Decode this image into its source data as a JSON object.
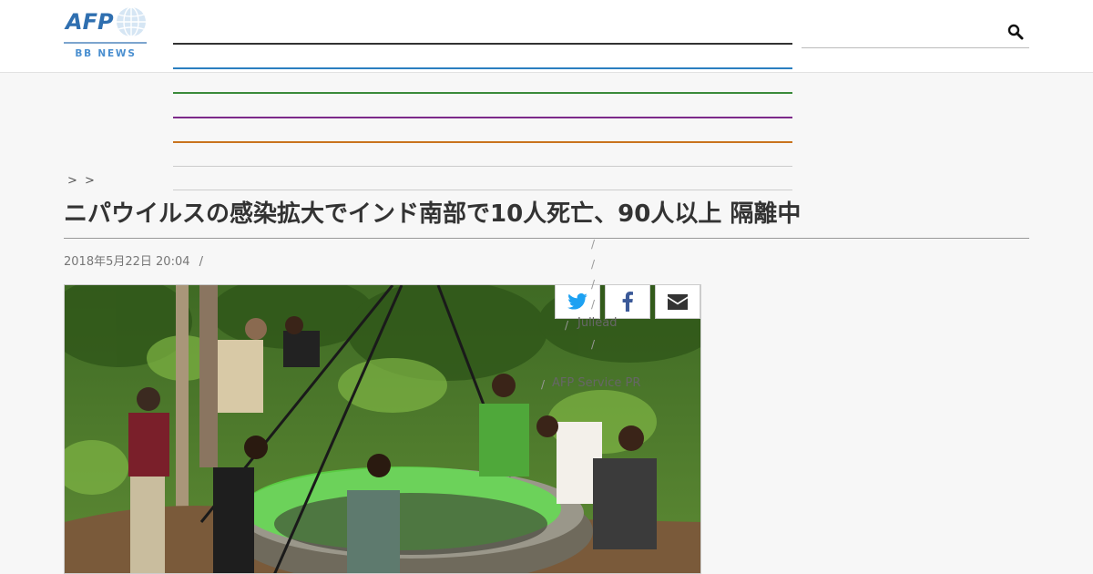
{
  "header": {
    "logo": {
      "brand": "AFP",
      "sub": "BB NEWS"
    },
    "nav_lines": [
      {
        "color": "#333333"
      },
      {
        "color": "#2a7fc0"
      },
      {
        "color": "#3a8a3a"
      },
      {
        "color": "#7d2a8a"
      },
      {
        "color": "#c9741e"
      },
      {
        "color": "#cccccc"
      },
      {
        "color": "#cccccc"
      }
    ]
  },
  "breadcrumb": {
    "sep1": ">",
    "sep2": ">"
  },
  "article": {
    "title": "ニパウイルスの感染拡大でインド南部で10人死亡、90人以上 隔離中",
    "date": "2018年5月22日 20:04",
    "date_sep": "/",
    "photo_alt": "Health workers with masks lowering a green net over a stone well"
  },
  "share": {
    "twitter": "twitter-icon",
    "facebook": "facebook-icon",
    "email": "envelope-icon"
  },
  "sidebar": {
    "slashes": [
      "/",
      "/",
      "/",
      "/",
      "/",
      "/",
      "/"
    ],
    "link1": "Jullead",
    "link2": "AFP Service PR"
  }
}
